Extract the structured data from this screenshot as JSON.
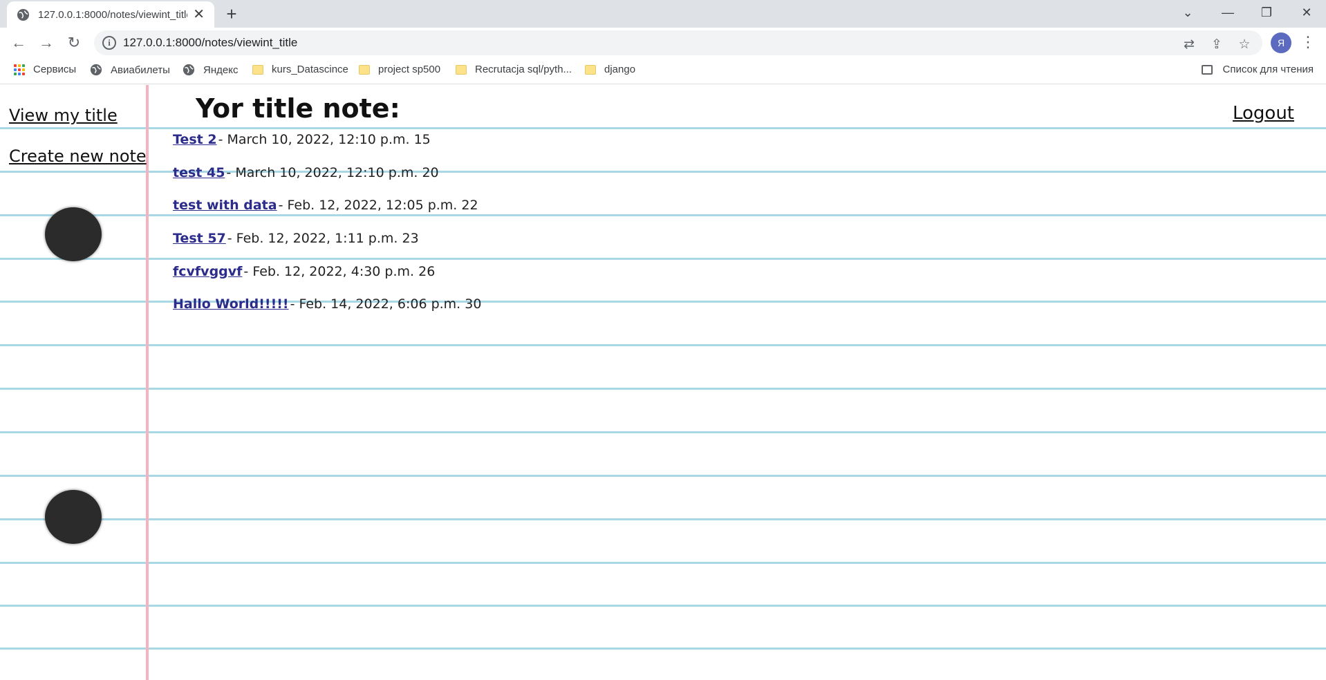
{
  "browser": {
    "tab_title": "127.0.0.1:8000/notes/viewint_title",
    "url": "127.0.0.1:8000/notes/viewint_title",
    "profile_initial": "Я",
    "bookmarks": [
      {
        "label": "Сервисы",
        "icon": "apps-icon"
      },
      {
        "label": "Авиабилеты",
        "icon": "globe-icon"
      },
      {
        "label": "Яндекс",
        "icon": "globe-icon"
      },
      {
        "label": "kurs_Datascince",
        "icon": "folder-icon"
      },
      {
        "label": "project sp500",
        "icon": "folder-icon"
      },
      {
        "label": "Recrutacja sql/pyth...",
        "icon": "folder-icon"
      },
      {
        "label": "django",
        "icon": "folder-icon"
      }
    ],
    "reading_list": "Список для чтения"
  },
  "sidebar": {
    "view_title": "View my title",
    "create_note": "Create new note"
  },
  "main": {
    "heading": "Yor title note:",
    "logout": "Logout",
    "notes": [
      {
        "title": "Test 2",
        "meta": "- March 10, 2022, 12:10 p.m. 15"
      },
      {
        "title": "test 45",
        "meta": "- March 10, 2022, 12:10 p.m. 20"
      },
      {
        "title": "test with data",
        "meta": "- Feb. 12, 2022, 12:05 p.m. 22"
      },
      {
        "title": "Test 57",
        "meta": "- Feb. 12, 2022, 1:11 p.m. 23"
      },
      {
        "title": "fcvfvggvf",
        "meta": "- Feb. 12, 2022, 4:30 p.m. 26"
      },
      {
        "title": "Hallo World!!!!!",
        "meta": "- Feb. 14, 2022, 6:06 p.m. 30"
      }
    ]
  },
  "colors": {
    "rule_line": "#a8d8e6",
    "margin_line": "#f5b2bf",
    "note_link": "#2c2c8a",
    "hole": "#2b2b2b"
  }
}
